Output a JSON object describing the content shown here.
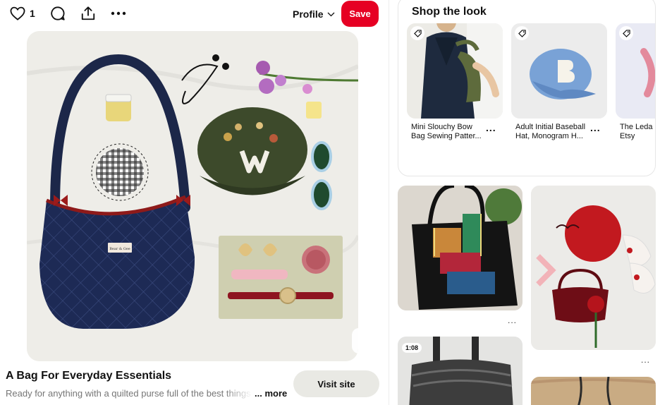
{
  "toolbar": {
    "like_count": "1",
    "profile_label": "Profile",
    "save_label": "Save",
    "icons": [
      "heart-icon",
      "comment-icon",
      "share-icon",
      "more-icon"
    ]
  },
  "pin": {
    "title": "A Bag For Everyday Essentials",
    "description": "Ready for anything with a quilted purse full of the best things",
    "more_label": "... more",
    "visit_label": "Visit site",
    "image_badge": "Bear & Gee"
  },
  "shop": {
    "title": "Shop the look",
    "products": [
      {
        "name_line1": "Mini Slouchy Bow",
        "name_line2": "Bag Sewing Patter..."
      },
      {
        "name_line1": "Adult Initial Baseball",
        "name_line2": "Hat, Monogram H..."
      },
      {
        "name_line1": "The Leda E",
        "name_line2": "Etsy"
      }
    ],
    "more_label": "..."
  },
  "feed": {
    "more_label": "...",
    "video_duration": "1:08"
  },
  "colors": {
    "save_red": "#e60023",
    "visit_gray": "#e9e9e4",
    "text_secondary": "#767676"
  }
}
